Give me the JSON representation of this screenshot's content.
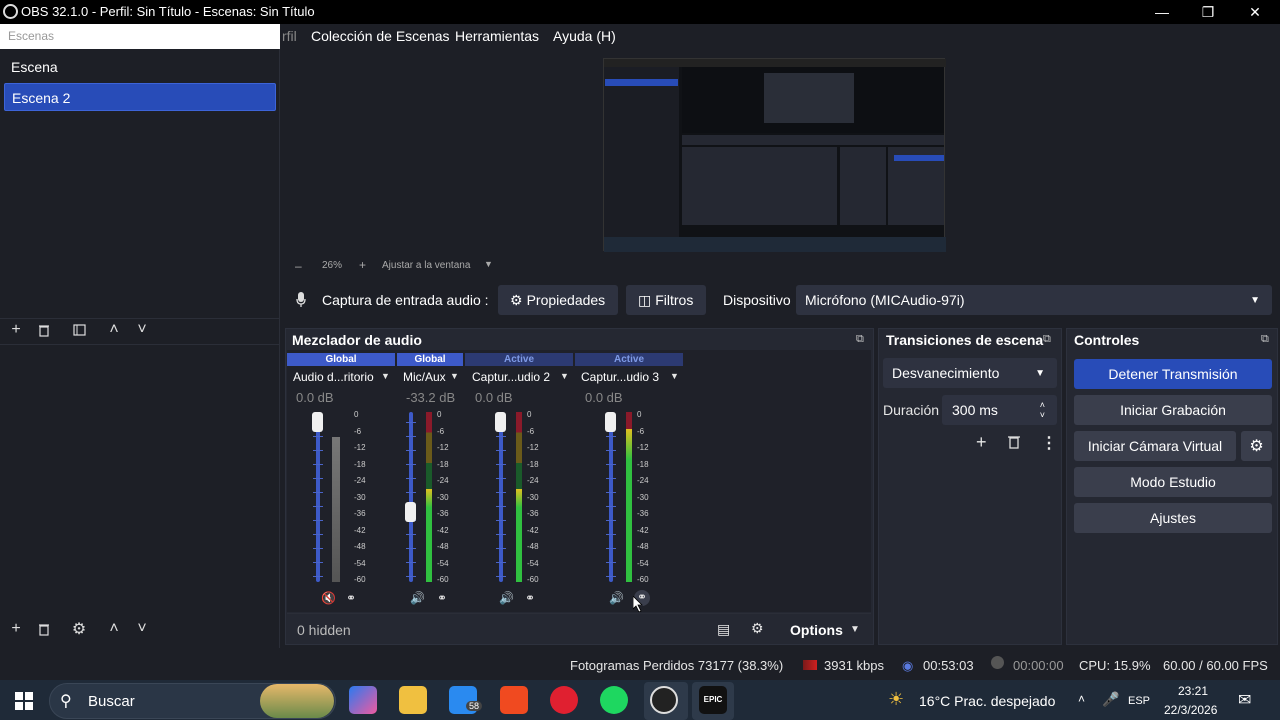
{
  "window": {
    "title": "OBS 32.1.0 - Perfil: Sin Título - Escenas: Sin Título"
  },
  "menu": {
    "partial": "rfil",
    "scene_collection": "Colección de Escenas",
    "tools": "Herramientas",
    "help": "Ayuda (H)"
  },
  "scenes": {
    "search_placeholder": "Escenas",
    "items": [
      "Escena",
      "Escena 2"
    ],
    "selected_index": 1
  },
  "preview": {
    "zoom": "26%",
    "fit": "Ajustar a la ventana"
  },
  "source_bar": {
    "label": "Captura de entrada audio :",
    "properties": "Propiedades",
    "filters": "Filtros",
    "device_label": "Dispositivo",
    "device_value": "Micrófono (MICAudio-97i)"
  },
  "mixer": {
    "title": "Mezclador de audio",
    "scale": [
      "0",
      "-6",
      "-12",
      "-18",
      "-24",
      "-30",
      "-36",
      "-42",
      "-48",
      "-54",
      "-60"
    ],
    "channels": [
      {
        "badge": "Global",
        "name": "Audio d...ritorio",
        "db": "0.0 dB",
        "muted": true,
        "fader": 1.0
      },
      {
        "badge": "Global",
        "name": "Mic/Aux",
        "db": "-33.2 dB",
        "muted": false,
        "fader": 0.4
      },
      {
        "badge": "Active",
        "name": "Captur...udio 2",
        "db": "0.0 dB",
        "muted": false,
        "fader": 1.0
      },
      {
        "badge": "Active",
        "name": "Captur...udio 3",
        "db": "0.0 dB",
        "muted": false,
        "fader": 1.0
      }
    ],
    "hidden": "0 hidden",
    "options": "Options"
  },
  "transitions": {
    "title": "Transiciones de escena",
    "selected": "Desvanecimiento",
    "duration_label": "Duración",
    "duration_value": "300 ms"
  },
  "controls": {
    "title": "Controles",
    "stop_stream": "Detener Transmisión",
    "start_record": "Iniciar Grabación",
    "virtual_cam": "Iniciar Cámara Virtual",
    "studio_mode": "Modo Estudio",
    "settings": "Ajustes"
  },
  "status": {
    "dropped": "Fotogramas Perdidos 73177 (38.3%)",
    "bitrate": "3931 kbps",
    "stream_time": "00:53:03",
    "rec_time": "00:00:00",
    "cpu": "CPU: 15.9%",
    "fps": "60.00 / 60.00 FPS"
  },
  "taskbar": {
    "search": "Buscar",
    "weather": "16°C  Prac. despejado",
    "lang": "ESP",
    "time": "23:21",
    "date": "22/3/2026",
    "mail_badge": "58"
  },
  "colors": {
    "accent": "#284cb8",
    "badge_global": "#3d5ac8",
    "badge_active": "#3d5ac8"
  }
}
